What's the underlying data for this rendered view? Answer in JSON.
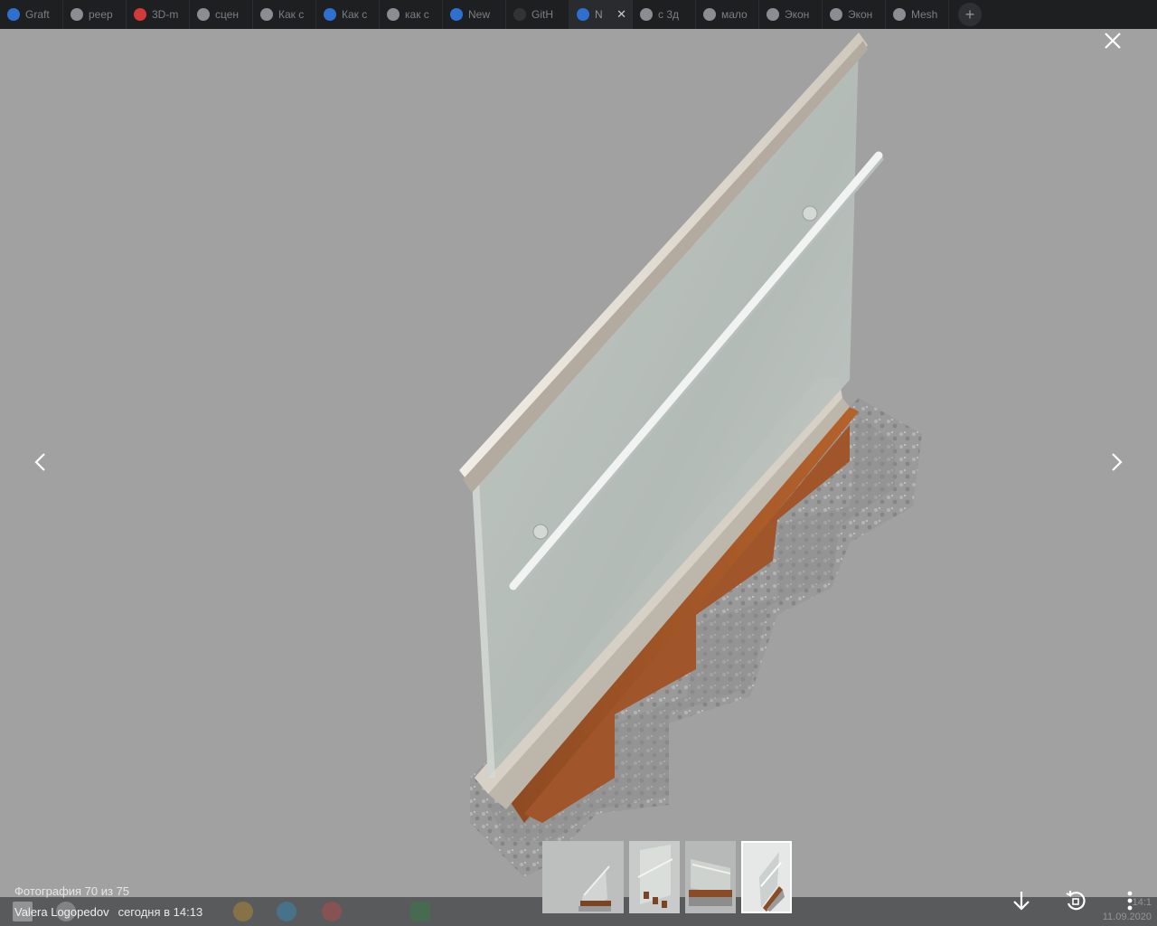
{
  "browser": {
    "tabs": [
      {
        "label": "Graft",
        "color": "#2f6fd0"
      },
      {
        "label": "реер",
        "color": "#8a8d92"
      },
      {
        "label": "3D-m",
        "color": "#d23a3a"
      },
      {
        "label": "сцен",
        "color": "#8a8d92"
      },
      {
        "label": "Как с",
        "color": "#8a8d92"
      },
      {
        "label": "Как с",
        "color": "#2f6fd0"
      },
      {
        "label": "как с",
        "color": "#8a8d92"
      },
      {
        "label": "New",
        "color": "#2f6fd0"
      },
      {
        "label": "GitH",
        "color": "#333333"
      },
      {
        "label": "N",
        "color": "#2f6fd0",
        "active": true
      },
      {
        "label": "с 3д",
        "color": "#8a8d92"
      },
      {
        "label": "мало",
        "color": "#8a8d92"
      },
      {
        "label": "Экон",
        "color": "#8a8d92"
      },
      {
        "label": "Экон",
        "color": "#8a8d92"
      },
      {
        "label": "Mesh",
        "color": "#8a8d92"
      }
    ],
    "new_tab_label": "+",
    "tab_close_glyph": "✕"
  },
  "viewer": {
    "counter": "Фотография 70 из 75",
    "author": "Valera Logopedov",
    "timestamp": "сегодня в 14:13",
    "icons": {
      "close": "close-icon",
      "prev": "chevron-left-icon",
      "next": "chevron-right-icon",
      "download": "download-icon",
      "rotate": "rotate-icon",
      "more": "more-icon"
    },
    "thumbnails": [
      {
        "kind": "railing-front",
        "active": false
      },
      {
        "kind": "railing-glass",
        "active": false
      },
      {
        "kind": "railing-side",
        "active": false
      },
      {
        "kind": "railing-iso",
        "active": true
      }
    ]
  },
  "system": {
    "time": "14:1",
    "date": "11.09.2020"
  }
}
